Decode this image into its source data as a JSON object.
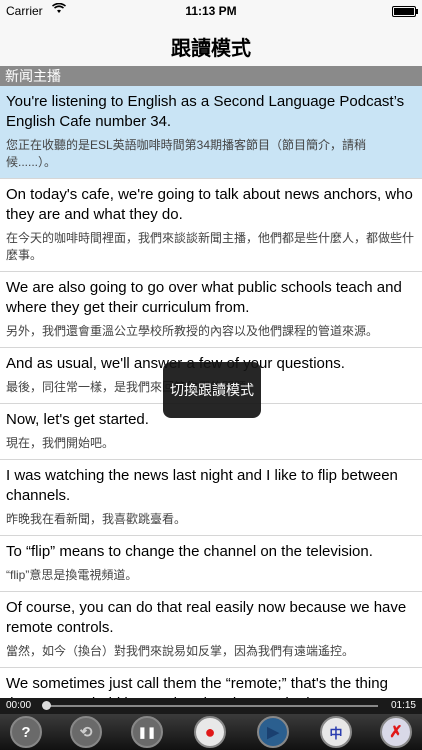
{
  "status_bar": {
    "carrier": "Carrier",
    "time": "11:13 PM"
  },
  "nav": {
    "title": "跟讀模式"
  },
  "section_header": "新闻主播",
  "rows": [
    {
      "en": "You're listening to English as a Second Language Podcast’s English Cafe number 34.",
      "zh": "您正在收聽的是ESL英語咖啡時間第34期播客節目（節目簡介，請稍候......）。"
    },
    {
      "en": "On today's cafe, we're going to talk about news anchors, who they are and what they do.",
      "zh": "在今天的咖啡時間裡面，我們來談談新聞主播，他們都是些什麼人，都做些什麼事。"
    },
    {
      "en": "We are also going to go over what public schools teach and where they get their curriculum from.",
      "zh": "另外，我們還會重溫公立學校所教授的內容以及他們課程的管道來源。"
    },
    {
      "en": "And as usual, we'll answer a few of your questions.",
      "zh": "最後，同往常一樣，是我們來回答你們的問題。"
    },
    {
      "en": "Now, let's get started.",
      "zh": "現在，我們開始吧。"
    },
    {
      "en": "I was watching the news last night and I like to flip between channels.",
      "zh": "昨晚我在看新聞，我喜歡跳臺看。"
    },
    {
      "en": "To “flip” means to change the channel on the television.",
      "zh": "“flip”意思是換電視頻道。"
    },
    {
      "en": "Of course, you can do that real easily now because we have remote controls.",
      "zh": "當然，如今（換台）對我們來說易如反掌，因為我們有遠端遙控。"
    },
    {
      "en": "We sometimes just call them the “remote;” that's the thing that you can hold in your hand and press the button to change the channels or to increase or decrease the",
      "zh": ""
    }
  ],
  "toast": "切換跟讀模式",
  "player": {
    "current": "00:00",
    "total": "01:15",
    "progress": 0.0
  },
  "toolbar": {
    "help": "?",
    "repeat": "⟲",
    "pause": "❚❚",
    "record": "●",
    "play": "▶",
    "chinese": "中",
    "shadow": "✗"
  },
  "colors": {
    "accent_row": "#c9e4f5",
    "section_bg": "#8a8a8a",
    "record": "#e01818",
    "chinese": "#2a3db0"
  }
}
